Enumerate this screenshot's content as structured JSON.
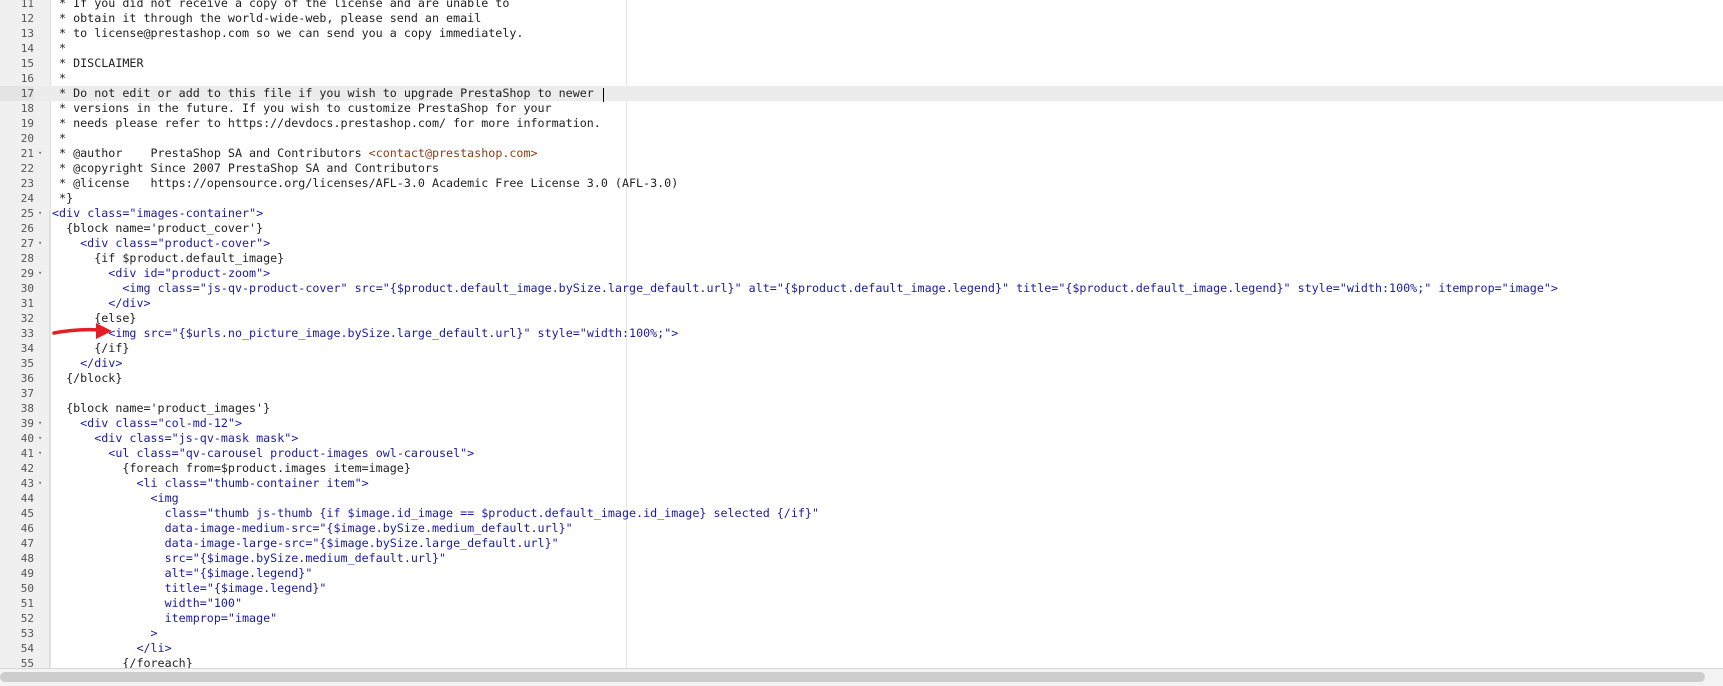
{
  "editor": {
    "lines": [
      {
        "n": "11",
        "fold": false,
        "tokens": [
          {
            "t": " * If you did not receive a copy of the license and are unable to",
            "c": "text"
          }
        ]
      },
      {
        "n": "12",
        "fold": false,
        "tokens": [
          {
            "t": " * obtain it through the world-wide-web, please send an email",
            "c": "text"
          }
        ]
      },
      {
        "n": "13",
        "fold": false,
        "tokens": [
          {
            "t": " * to license@prestashop.com so we can send you a copy immediately.",
            "c": "text"
          }
        ]
      },
      {
        "n": "14",
        "fold": false,
        "tokens": [
          {
            "t": " *",
            "c": "text"
          }
        ]
      },
      {
        "n": "15",
        "fold": false,
        "tokens": [
          {
            "t": " * DISCLAIMER",
            "c": "text"
          }
        ]
      },
      {
        "n": "16",
        "fold": false,
        "tokens": [
          {
            "t": " *",
            "c": "text"
          }
        ]
      },
      {
        "n": "17",
        "fold": false,
        "active": true,
        "tokens": [
          {
            "t": " * Do not edit or add to this file if you wish to upgrade PrestaShop to newer",
            "c": "text"
          }
        ]
      },
      {
        "n": "18",
        "fold": false,
        "tokens": [
          {
            "t": " * versions in the future. If you wish to customize PrestaShop for your",
            "c": "text"
          }
        ]
      },
      {
        "n": "19",
        "fold": false,
        "tokens": [
          {
            "t": " * needs please refer to https://devdocs.prestashop.com/ for more information.",
            "c": "text"
          }
        ]
      },
      {
        "n": "20",
        "fold": false,
        "tokens": [
          {
            "t": " *",
            "c": "text"
          }
        ]
      },
      {
        "n": "21",
        "fold": true,
        "tokens": [
          {
            "t": " * @author    PrestaShop SA and Contributors ",
            "c": "text"
          },
          {
            "t": "<contact@prestashop.com>",
            "c": "link"
          }
        ]
      },
      {
        "n": "22",
        "fold": false,
        "tokens": [
          {
            "t": " * @copyright Since 2007 PrestaShop SA and Contributors",
            "c": "text"
          }
        ]
      },
      {
        "n": "23",
        "fold": false,
        "tokens": [
          {
            "t": " * @license   https://opensource.org/licenses/AFL-3.0 Academic Free License 3.0 (AFL-3.0)",
            "c": "text"
          }
        ]
      },
      {
        "n": "24",
        "fold": false,
        "tokens": [
          {
            "t": " *}",
            "c": "text"
          }
        ]
      },
      {
        "n": "25",
        "fold": true,
        "tokens": [
          {
            "t": "<div ",
            "c": "tag"
          },
          {
            "t": "class=",
            "c": "attr"
          },
          {
            "t": "\"images-container\">",
            "c": "str"
          }
        ]
      },
      {
        "n": "26",
        "fold": false,
        "tokens": [
          {
            "t": "  {block name='product_cover'}",
            "c": "smarty"
          }
        ]
      },
      {
        "n": "27",
        "fold": true,
        "tokens": [
          {
            "t": "    <div ",
            "c": "tag"
          },
          {
            "t": "class=",
            "c": "attr"
          },
          {
            "t": "\"product-cover\">",
            "c": "str"
          }
        ]
      },
      {
        "n": "28",
        "fold": false,
        "tokens": [
          {
            "t": "      {if $product.default_image}",
            "c": "smarty"
          }
        ]
      },
      {
        "n": "29",
        "fold": true,
        "tokens": [
          {
            "t": "        <div ",
            "c": "tag"
          },
          {
            "t": "id=",
            "c": "attr"
          },
          {
            "t": "\"product-zoom\">",
            "c": "str"
          }
        ]
      },
      {
        "n": "30",
        "fold": false,
        "tokens": [
          {
            "t": "          <img ",
            "c": "tag"
          },
          {
            "t": "class=",
            "c": "attr"
          },
          {
            "t": "\"js-qv-product-cover\" ",
            "c": "str"
          },
          {
            "t": "src=",
            "c": "attr"
          },
          {
            "t": "\"{$product.default_image.bySize.large_default.url}\" ",
            "c": "str"
          },
          {
            "t": "alt=",
            "c": "attr"
          },
          {
            "t": "\"{$product.default_image.legend}\" ",
            "c": "str"
          },
          {
            "t": "title=",
            "c": "attr"
          },
          {
            "t": "\"{$product.default_image.legend}\" ",
            "c": "str"
          },
          {
            "t": "style=",
            "c": "attr"
          },
          {
            "t": "\"width:100%;\" ",
            "c": "str"
          },
          {
            "t": "itemprop=",
            "c": "attr"
          },
          {
            "t": "\"image\">",
            "c": "str"
          }
        ]
      },
      {
        "n": "31",
        "fold": false,
        "tokens": [
          {
            "t": "        </div>",
            "c": "tag"
          }
        ]
      },
      {
        "n": "32",
        "fold": false,
        "tokens": [
          {
            "t": "      {else}",
            "c": "smarty"
          }
        ]
      },
      {
        "n": "33",
        "fold": false,
        "tokens": [
          {
            "t": "        <img ",
            "c": "tag"
          },
          {
            "t": "src=",
            "c": "attr"
          },
          {
            "t": "\"{$urls.no_picture_image.bySize.large_default.url}\" ",
            "c": "str"
          },
          {
            "t": "style=",
            "c": "attr"
          },
          {
            "t": "\"width:100%;\">",
            "c": "str"
          }
        ]
      },
      {
        "n": "34",
        "fold": false,
        "tokens": [
          {
            "t": "      {/if}",
            "c": "smarty"
          }
        ]
      },
      {
        "n": "35",
        "fold": false,
        "tokens": [
          {
            "t": "    </div>",
            "c": "tag"
          }
        ]
      },
      {
        "n": "36",
        "fold": false,
        "tokens": [
          {
            "t": "  {/block}",
            "c": "smarty"
          }
        ]
      },
      {
        "n": "37",
        "fold": false,
        "tokens": []
      },
      {
        "n": "38",
        "fold": false,
        "tokens": [
          {
            "t": "  {block name='product_images'}",
            "c": "smarty"
          }
        ]
      },
      {
        "n": "39",
        "fold": true,
        "tokens": [
          {
            "t": "    <div ",
            "c": "tag"
          },
          {
            "t": "class=",
            "c": "attr"
          },
          {
            "t": "\"col-md-12\">",
            "c": "str"
          }
        ]
      },
      {
        "n": "40",
        "fold": true,
        "tokens": [
          {
            "t": "      <div ",
            "c": "tag"
          },
          {
            "t": "class=",
            "c": "attr"
          },
          {
            "t": "\"js-qv-mask mask\">",
            "c": "str"
          }
        ]
      },
      {
        "n": "41",
        "fold": true,
        "tokens": [
          {
            "t": "        <ul ",
            "c": "tag"
          },
          {
            "t": "class=",
            "c": "attr"
          },
          {
            "t": "\"qv-carousel product-images owl-carousel\">",
            "c": "str"
          }
        ]
      },
      {
        "n": "42",
        "fold": false,
        "tokens": [
          {
            "t": "          {foreach from=$product.images item=image}",
            "c": "smarty"
          }
        ]
      },
      {
        "n": "43",
        "fold": true,
        "tokens": [
          {
            "t": "            <li ",
            "c": "tag"
          },
          {
            "t": "class=",
            "c": "attr"
          },
          {
            "t": "\"thumb-container item\">",
            "c": "str"
          }
        ]
      },
      {
        "n": "44",
        "fold": false,
        "tokens": [
          {
            "t": "              <img",
            "c": "tag"
          }
        ]
      },
      {
        "n": "45",
        "fold": false,
        "tokens": [
          {
            "t": "                class=",
            "c": "attr"
          },
          {
            "t": "\"thumb js-thumb {if $image.id_image == $product.default_image.id_image} selected {/if}\"",
            "c": "str"
          }
        ]
      },
      {
        "n": "46",
        "fold": false,
        "tokens": [
          {
            "t": "                data-image-medium-src=",
            "c": "attr"
          },
          {
            "t": "\"{$image.bySize.medium_default.url}\"",
            "c": "str"
          }
        ]
      },
      {
        "n": "47",
        "fold": false,
        "tokens": [
          {
            "t": "                data-image-large-src=",
            "c": "attr"
          },
          {
            "t": "\"{$image.bySize.large_default.url}\"",
            "c": "str"
          }
        ]
      },
      {
        "n": "48",
        "fold": false,
        "tokens": [
          {
            "t": "                src=",
            "c": "attr"
          },
          {
            "t": "\"{$image.bySize.medium_default.url}\"",
            "c": "str"
          }
        ]
      },
      {
        "n": "49",
        "fold": false,
        "tokens": [
          {
            "t": "                alt=",
            "c": "attr"
          },
          {
            "t": "\"{$image.legend}\"",
            "c": "str"
          }
        ]
      },
      {
        "n": "50",
        "fold": false,
        "tokens": [
          {
            "t": "                title=",
            "c": "attr"
          },
          {
            "t": "\"{$image.legend}\"",
            "c": "str"
          }
        ]
      },
      {
        "n": "51",
        "fold": false,
        "tokens": [
          {
            "t": "                width=",
            "c": "attr"
          },
          {
            "t": "\"100\"",
            "c": "str"
          }
        ]
      },
      {
        "n": "52",
        "fold": false,
        "tokens": [
          {
            "t": "                itemprop=",
            "c": "attr"
          },
          {
            "t": "\"image\"",
            "c": "str"
          }
        ]
      },
      {
        "n": "53",
        "fold": false,
        "tokens": [
          {
            "t": "              >",
            "c": "tag"
          }
        ]
      },
      {
        "n": "54",
        "fold": false,
        "tokens": [
          {
            "t": "            </li>",
            "c": "tag"
          }
        ]
      },
      {
        "n": "55",
        "fold": false,
        "tokens": [
          {
            "t": "          {/foreach}",
            "c": "smarty"
          }
        ]
      }
    ]
  },
  "colors": {
    "gutter_bg": "#f0f0f0",
    "active_line": "#ececec",
    "tag": "#1a1aa6",
    "link": "#8b3d14",
    "text": "#222222",
    "annotation_arrow": "#e31e24"
  },
  "icons": {
    "fold_marker": "fold-arrow-icon",
    "annotation": "red-arrow-annotation-icon"
  }
}
